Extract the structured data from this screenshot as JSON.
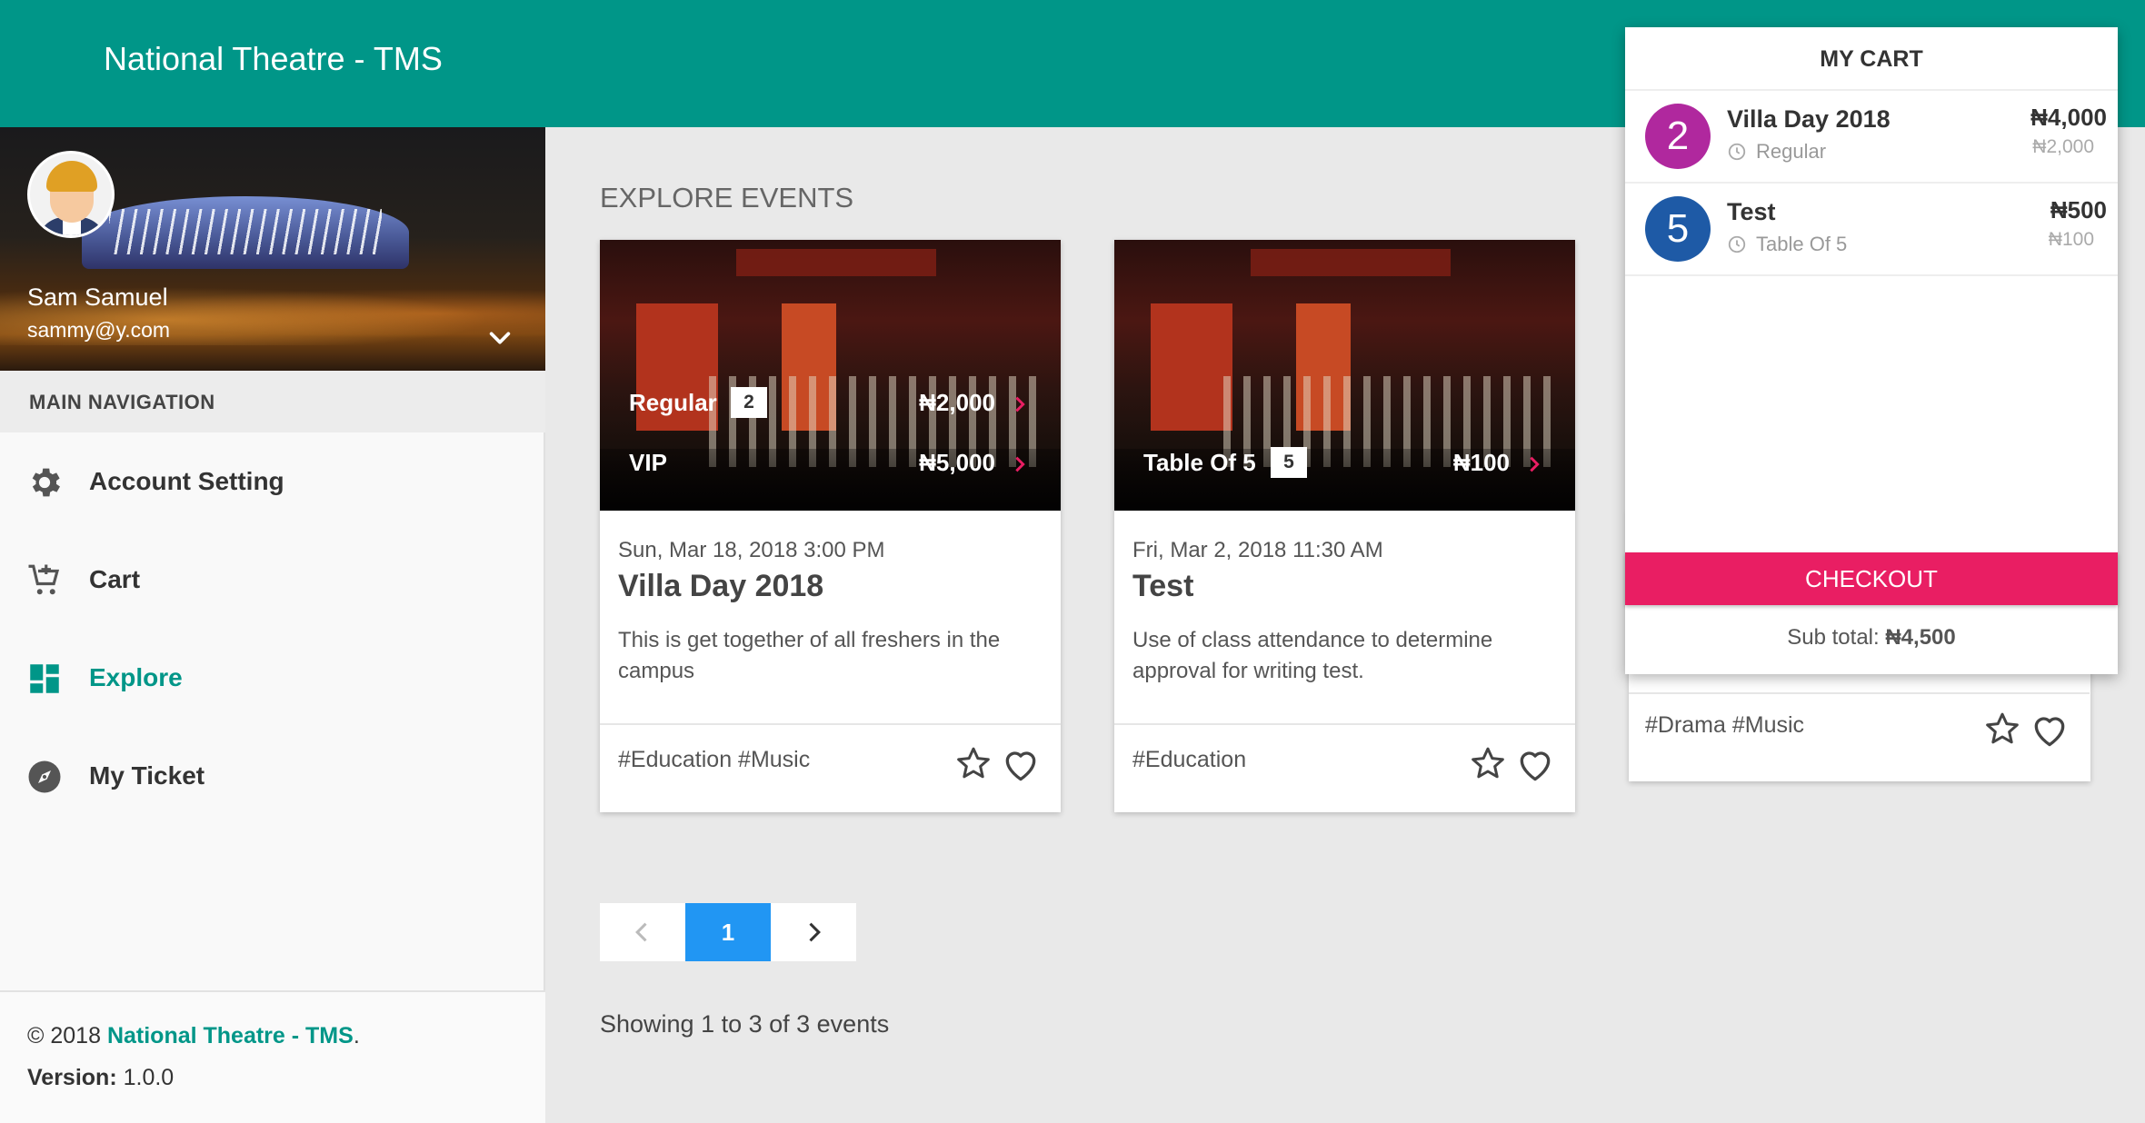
{
  "app": {
    "title": "National Theatre - TMS"
  },
  "user": {
    "name": "Sam Samuel",
    "email": "sammy@y.com"
  },
  "sidebar": {
    "header": "MAIN NAVIGATION",
    "items": [
      {
        "label": "Account Setting",
        "icon": "gear-icon"
      },
      {
        "label": "Cart",
        "icon": "cart-icon"
      },
      {
        "label": "Explore",
        "icon": "dashboard-icon",
        "active": true
      },
      {
        "label": "My Ticket",
        "icon": "compass-icon"
      }
    ],
    "footer": {
      "copyright_prefix": "© 2018 ",
      "brand_link": "National Theatre - TMS",
      "suffix": ".",
      "version_label": "Version:",
      "version_value": "1.0.0"
    }
  },
  "main": {
    "title": "EXPLORE EVENTS",
    "events": [
      {
        "date": "Sun, Mar 18, 2018 3:00 PM",
        "title": "Villa Day 2018",
        "description": "This is get together of all freshers in the campus",
        "tags": "#Education #Music",
        "tickets": [
          {
            "name": "Regular",
            "qty": "2",
            "price": "₦2,000"
          },
          {
            "name": "VIP",
            "qty": "",
            "price": "₦5,000"
          }
        ]
      },
      {
        "date": "Fri, Mar 2, 2018 11:30 AM",
        "title": "Test",
        "description": "Use of class attendance to determine approval for writing test.",
        "tags": "#Education",
        "tickets": [
          {
            "name": "Table Of 5",
            "qty": "5",
            "price": "₦100"
          }
        ]
      },
      {
        "tags": "#Drama #Music"
      }
    ],
    "pagination": {
      "current": "1"
    },
    "showing": "Showing 1 to 3 of 3 events"
  },
  "cart": {
    "title": "MY CART",
    "items": [
      {
        "qty": "2",
        "name": "Villa Day 2018",
        "type": "Regular",
        "total": "₦4,000",
        "unit": "₦2,000",
        "color": "#b0289e"
      },
      {
        "qty": "5",
        "name": "Test",
        "type": "Table Of 5",
        "total": "₦500",
        "unit": "₦100",
        "color": "#1e5aa6"
      }
    ],
    "checkout_label": "CHECKOUT",
    "subtotal_label": "Sub total:",
    "subtotal_value": "₦4,500"
  },
  "colors": {
    "primary": "#009688",
    "accent": "#e91e63",
    "pager_active": "#2196f3"
  }
}
